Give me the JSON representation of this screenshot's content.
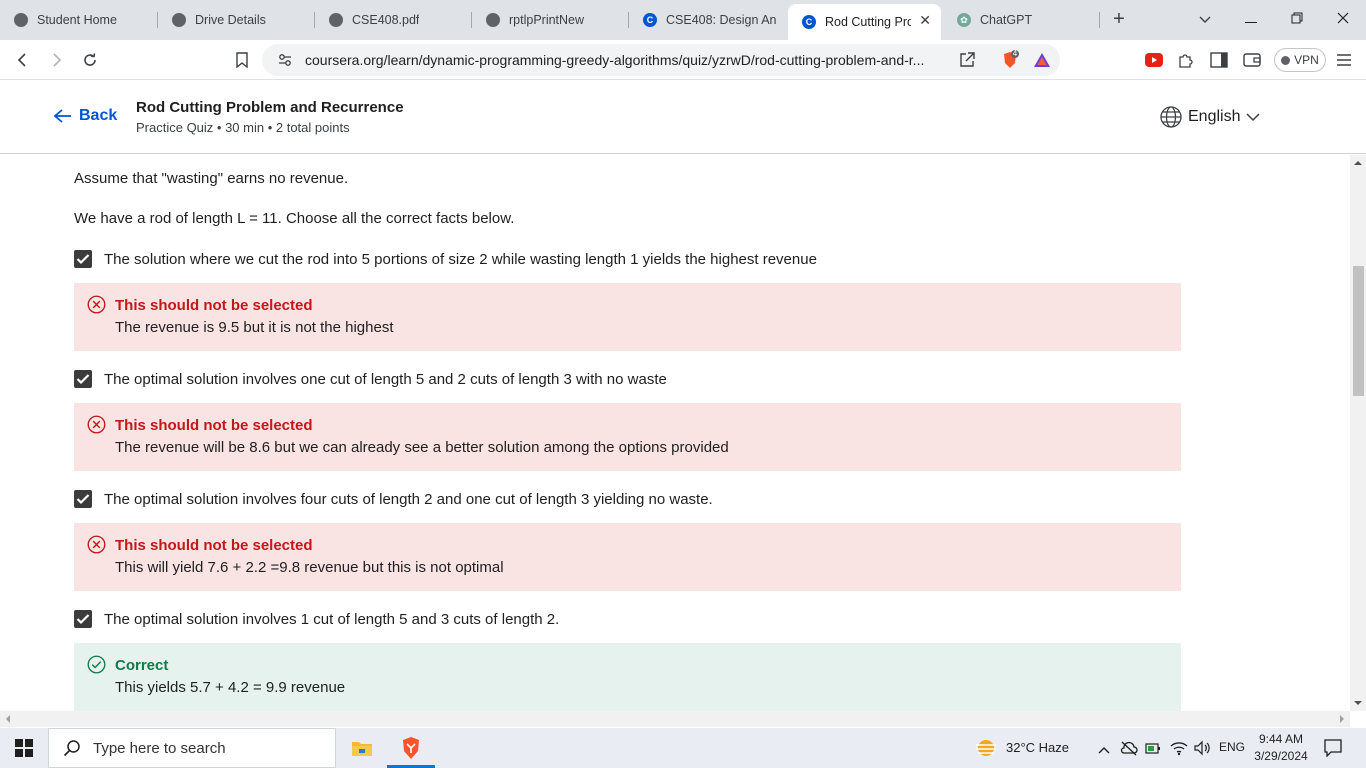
{
  "browser": {
    "tabs": [
      {
        "label": "Student Home",
        "icon": "globe-icon",
        "active": false
      },
      {
        "label": "Drive Details",
        "icon": "globe-icon",
        "active": false
      },
      {
        "label": "CSE408.pdf",
        "icon": "globe-icon",
        "active": false
      },
      {
        "label": "rptlpPrintNew",
        "icon": "globe-icon",
        "active": false
      },
      {
        "label": "CSE408: Design Anal",
        "icon": "coursera-icon",
        "active": false
      },
      {
        "label": "Rod Cutting Pro",
        "icon": "coursera-icon",
        "active": true
      },
      {
        "label": "ChatGPT",
        "icon": "chatgpt-icon",
        "active": false
      }
    ],
    "url": "coursera.org/learn/dynamic-programming-greedy-algorithms/quiz/yzrwD/rod-cutting-problem-and-r...",
    "brave_badge": "4",
    "vpn_label": "VPN"
  },
  "header": {
    "back_label": "Back",
    "title": "Rod Cutting Problem and Recurrence",
    "meta": "Practice Quiz • 30 min • 2 total points",
    "language": "English"
  },
  "content": {
    "intro1": "Assume that \"wasting\" earns no revenue.",
    "intro2": "We have a rod of length L = 11. Choose all the correct facts below.",
    "options": [
      {
        "text": "The solution where we cut the rod into 5 portions of size 2 while wasting length 1 yields the highest revenue",
        "checked": true,
        "feedback_status": "incorrect",
        "feedback_head": "This should not be selected",
        "feedback_body": "The revenue is 9.5 but it is not the highest"
      },
      {
        "text": "The optimal solution involves one cut of length 5 and 2 cuts of length 3 with no waste",
        "checked": true,
        "feedback_status": "incorrect",
        "feedback_head": "This should not be selected",
        "feedback_body": "The revenue will be 8.6 but we can already see a better solution among the options provided"
      },
      {
        "text": "The optimal solution involves four cuts of length 2 and one cut of length 3 yielding no waste.",
        "checked": true,
        "feedback_status": "incorrect",
        "feedback_head": "This should not be selected",
        "feedback_body": "This will yield 7.6 + 2.2 =9.8 revenue but this is not optimal"
      },
      {
        "text": "The optimal solution involves 1 cut of length 5 and 3 cuts of length 2.",
        "checked": true,
        "feedback_status": "correct",
        "feedback_head": "Correct",
        "feedback_body": "This yields 5.7 + 4.2 = 9.9 revenue"
      }
    ]
  },
  "colors": {
    "accent": "#0056d2",
    "error_text": "#c41818",
    "error_bg": "#f9e3e3",
    "success_text": "#137a4a",
    "success_bg": "#e6f2ee"
  },
  "taskbar": {
    "search_placeholder": "Type here to search",
    "weather": "32°C  Haze",
    "language": "ENG",
    "time": "9:44 AM",
    "date": "3/29/2024"
  }
}
